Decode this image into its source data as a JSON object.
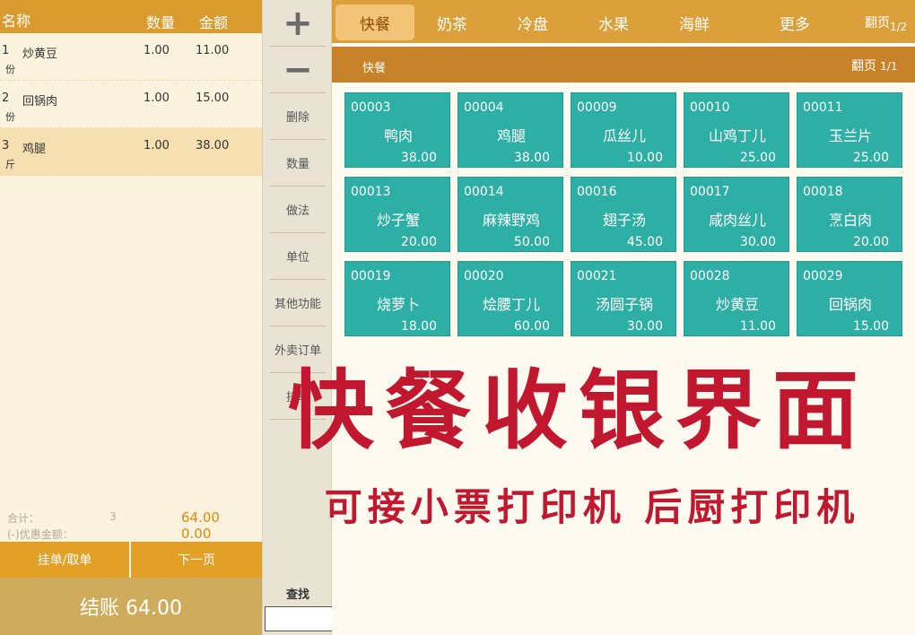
{
  "order": {
    "headers": {
      "name": "名称",
      "qty": "数量",
      "amount": "金额"
    },
    "rows": [
      {
        "index": "1",
        "name": "炒黄豆",
        "unit": "份",
        "qty": "1.00",
        "amount": "11.00"
      },
      {
        "index": "2",
        "name": "回锅肉",
        "unit": "份",
        "qty": "1.00",
        "amount": "15.00"
      },
      {
        "index": "3",
        "name": "鸡腿",
        "unit": "斤",
        "qty": "1.00",
        "amount": "38.00"
      }
    ],
    "totals": {
      "sum_label": "合计：",
      "count": "3",
      "sum_value": "64.00",
      "discount_label": "(-)优惠金额：",
      "discount_value": "0.00"
    },
    "hold_button": "挂单/取单",
    "next_button": "下一页",
    "checkout_button": "结账 64.00"
  },
  "functions": {
    "plus": "+",
    "minus": "−",
    "items": [
      "删除",
      "数量",
      "做法",
      "单位",
      "其他功能",
      "外卖订单",
      "挂单"
    ],
    "find_label": "查找",
    "find_value": ""
  },
  "categories": {
    "tabs": [
      "快餐",
      "奶茶",
      "冷盘",
      "水果",
      "海鲜",
      "更多"
    ],
    "active_index": 0,
    "page_label": "翻页",
    "page_value": "1/2"
  },
  "sub_bar": {
    "title": "快餐",
    "page_label": "翻页",
    "page_value": "1/1"
  },
  "products": [
    {
      "code": "00003",
      "name": "鸭肉",
      "price": "38.00"
    },
    {
      "code": "00004",
      "name": "鸡腿",
      "price": "38.00"
    },
    {
      "code": "00009",
      "name": "瓜丝儿",
      "price": "10.00"
    },
    {
      "code": "00010",
      "name": "山鸡丁儿",
      "price": "25.00"
    },
    {
      "code": "00011",
      "name": "玉兰片",
      "price": "25.00"
    },
    {
      "code": "00013",
      "name": "炒子蟹",
      "price": "20.00"
    },
    {
      "code": "00014",
      "name": "麻辣野鸡",
      "price": "50.00"
    },
    {
      "code": "00016",
      "name": "翅子汤",
      "price": "45.00"
    },
    {
      "code": "00017",
      "name": "咸肉丝儿",
      "price": "30.00"
    },
    {
      "code": "00018",
      "name": "烹白肉",
      "price": "20.00"
    },
    {
      "code": "00019",
      "name": "烧萝卜",
      "price": "18.00"
    },
    {
      "code": "00020",
      "name": "烩腰丁儿",
      "price": "60.00"
    },
    {
      "code": "00021",
      "name": "汤圆子锅",
      "price": "30.00"
    },
    {
      "code": "00028",
      "name": "炒黄豆",
      "price": "11.00"
    },
    {
      "code": "00029",
      "name": "回锅肉",
      "price": "15.00"
    }
  ],
  "banner": {
    "title": "快餐收银界面",
    "subtitle": "可接小票打印机 后厨打印机"
  },
  "colors": {
    "accent": "#d99b2e",
    "tile": "#2eafa5",
    "banner": "#c2182f",
    "amount": "#e08a0c"
  }
}
